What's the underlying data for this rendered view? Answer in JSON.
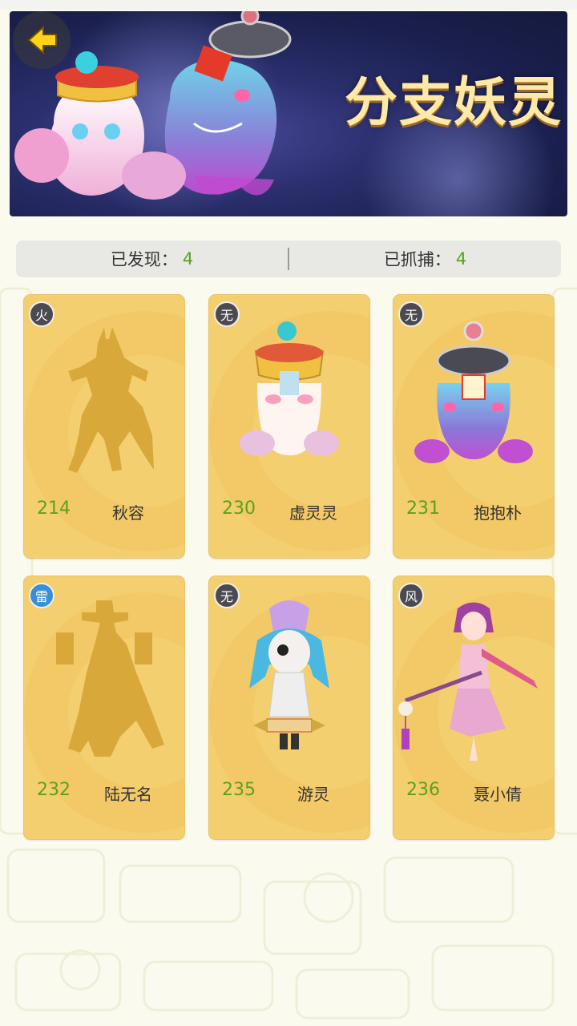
{
  "header": {
    "title": "分支妖灵"
  },
  "stats": {
    "discovered_label": "已发现：",
    "discovered_value": "4",
    "captured_label": "已抓捕：",
    "captured_value": "4"
  },
  "cards": [
    {
      "number": "214",
      "name": "秋容",
      "element": "火",
      "discovered": false
    },
    {
      "number": "230",
      "name": "虚灵灵",
      "element": "无",
      "discovered": true
    },
    {
      "number": "231",
      "name": "抱抱朴",
      "element": "无",
      "discovered": true
    },
    {
      "number": "232",
      "name": "陆无名",
      "element": "雷",
      "discovered": false
    },
    {
      "number": "235",
      "name": "游灵",
      "element": "无",
      "discovered": true
    },
    {
      "number": "236",
      "name": "聂小倩",
      "element": "风",
      "discovered": true
    }
  ],
  "colors": {
    "card_bg": "#f4cf6f",
    "number_green": "#5aa21c",
    "fire_badge": "#e0602a",
    "thunder_badge": "#3a8fd8",
    "wind_badge": "#3a8fd8",
    "none_badge": "#4a4a50"
  }
}
